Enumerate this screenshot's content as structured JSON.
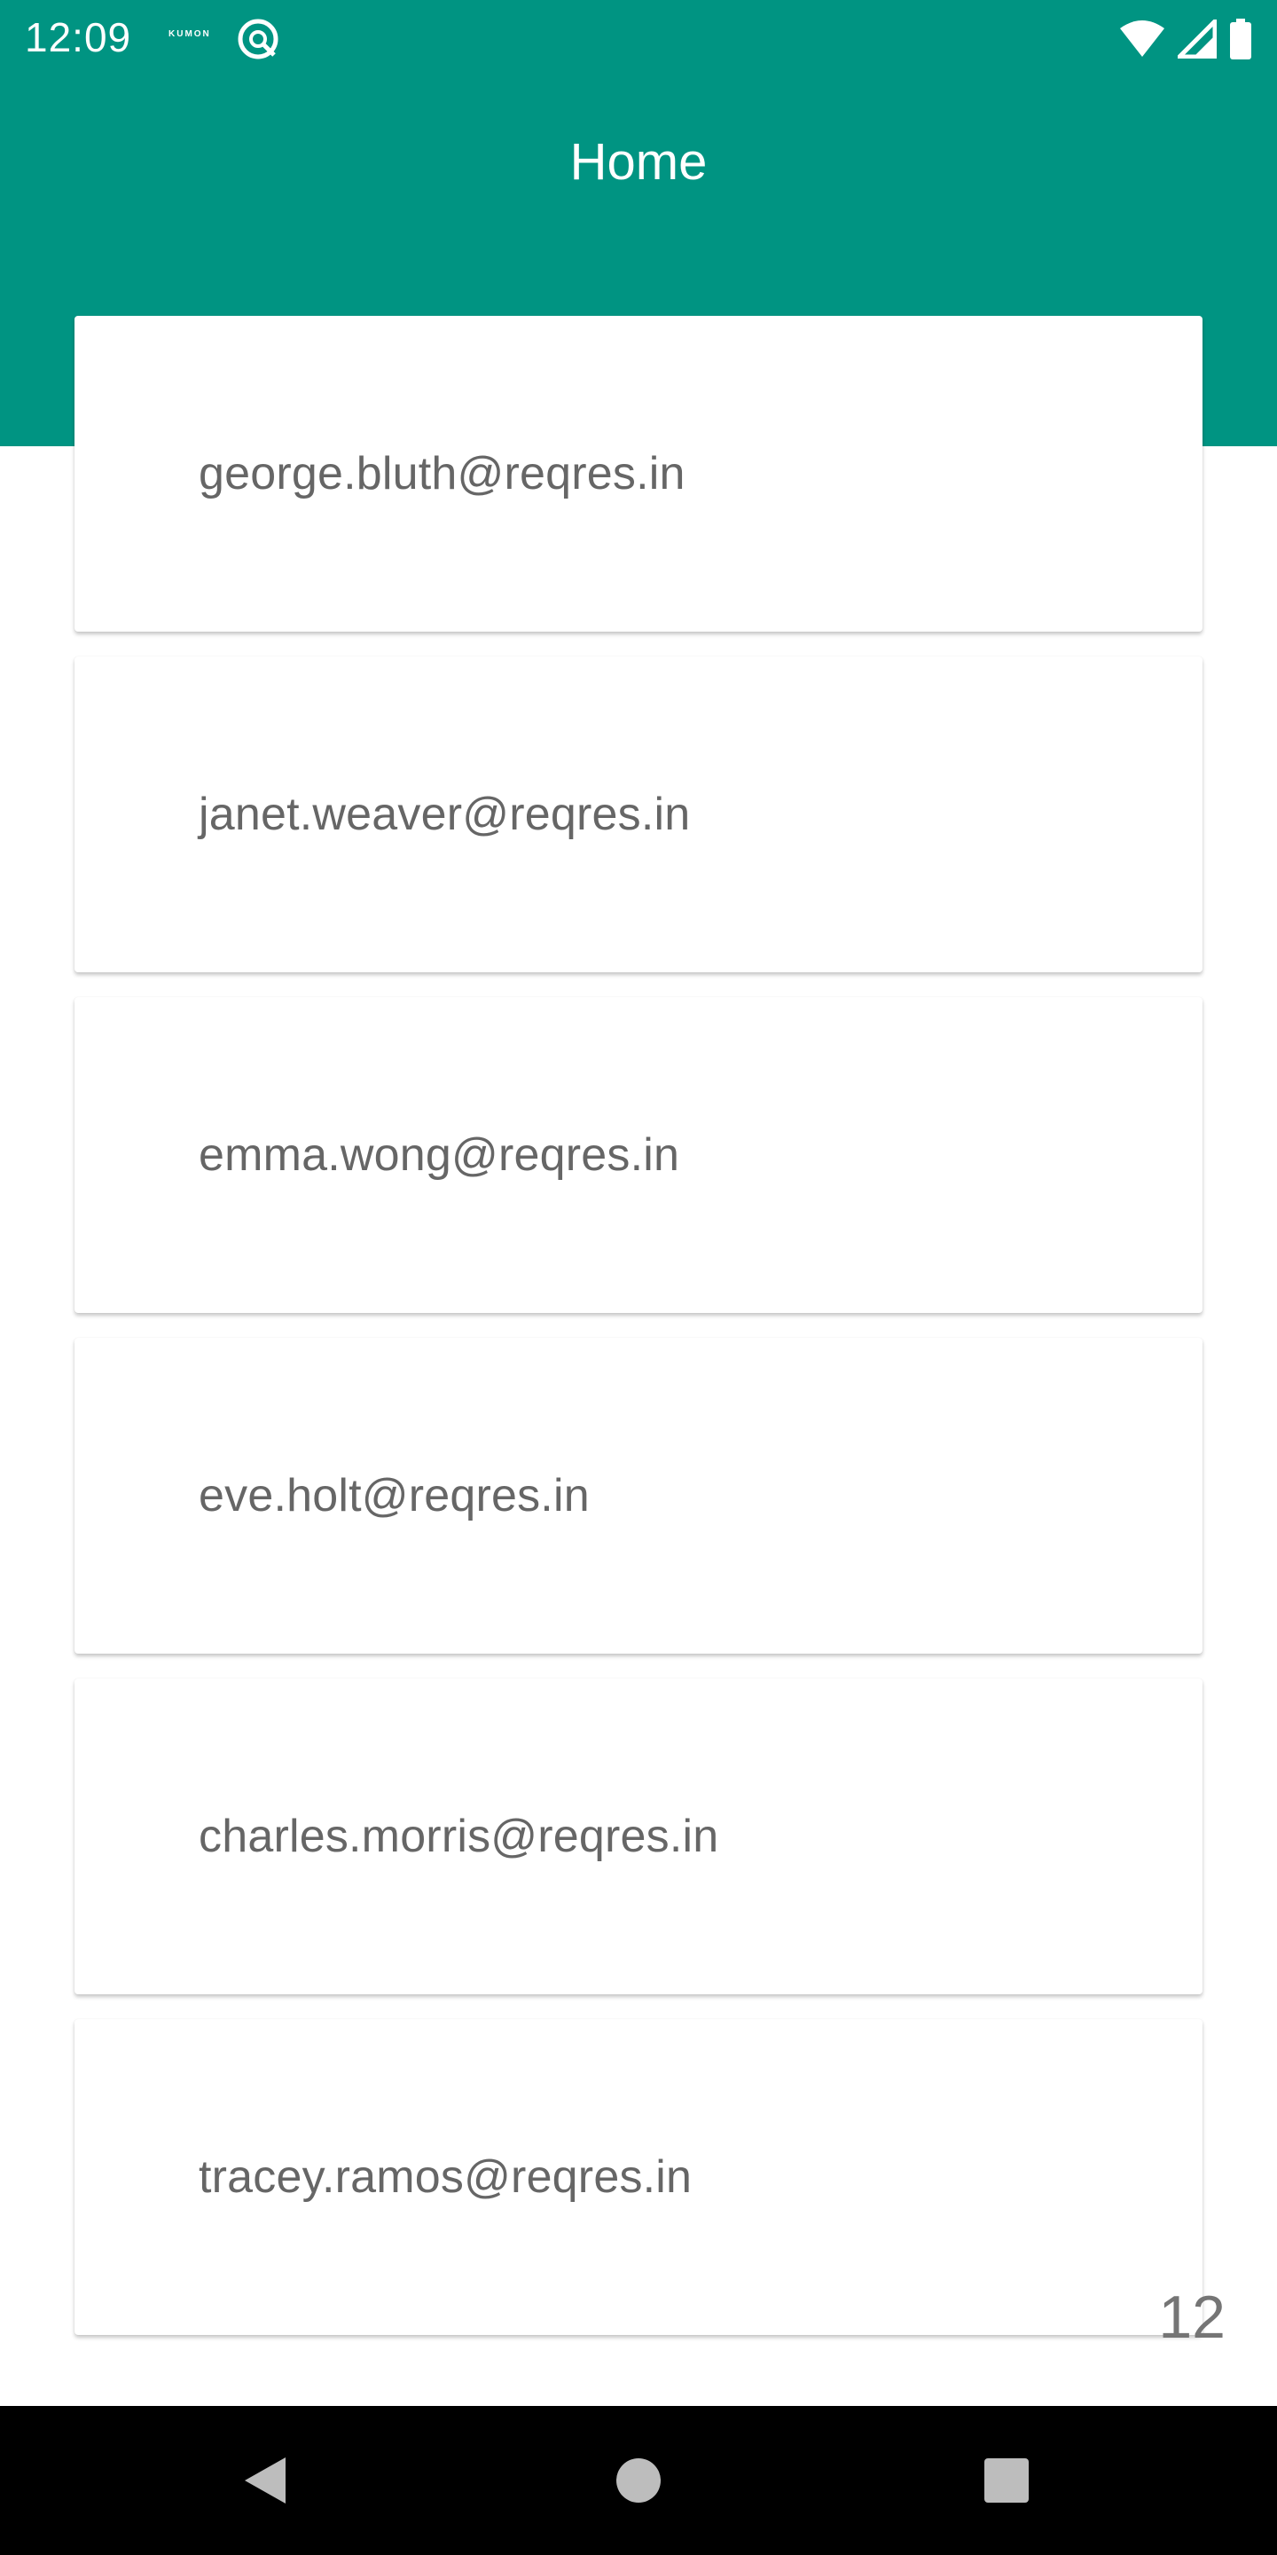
{
  "status_bar": {
    "time": "12:09",
    "notification_label": "KUMON",
    "app_icon": "reader-app-icon",
    "icons": [
      "wifi-icon",
      "cellular-signal-icon",
      "battery-icon"
    ]
  },
  "header": {
    "title": "Home"
  },
  "emails": [
    "george.bluth@reqres.in",
    "janet.weaver@reqres.in",
    "emma.wong@reqres.in",
    "eve.holt@reqres.in",
    "charles.morris@reqres.in",
    "tracey.ramos@reqres.in"
  ],
  "count": "12",
  "navigation": {
    "buttons": [
      "back-icon",
      "home-icon",
      "recents-icon"
    ]
  },
  "colors": {
    "header": "#009482",
    "text": "#666666",
    "navbar": "#000000"
  }
}
